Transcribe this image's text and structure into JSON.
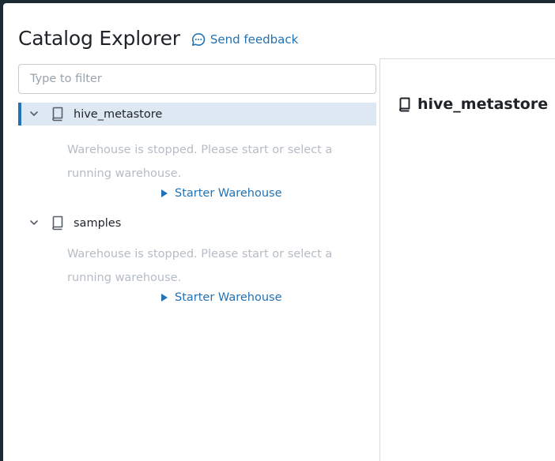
{
  "header": {
    "title": "Catalog Explorer",
    "feedback_label": "Send feedback",
    "feedback_icon": "chat-bubble-icon"
  },
  "filter": {
    "placeholder": "Type to filter",
    "value": ""
  },
  "catalogs": [
    {
      "name": "hive_metastore",
      "icon": "book-icon",
      "expanded": true,
      "selected": true,
      "message_line1": "Warehouse is stopped. Please start or select a",
      "message_line2": "running warehouse.",
      "warehouse_label": "Starter Warehouse"
    },
    {
      "name": "samples",
      "icon": "book-icon",
      "expanded": true,
      "selected": false,
      "message_line1": "Warehouse is stopped. Please start or select a",
      "message_line2": "running warehouse.",
      "warehouse_label": "Starter Warehouse"
    }
  ],
  "detail": {
    "title": "hive_metastore",
    "icon": "book-icon"
  },
  "colors": {
    "accent": "#2272b4",
    "selected_row": "#dde8f2",
    "muted_text": "#b5bcc3",
    "frame_bg": "#1b2a33"
  }
}
